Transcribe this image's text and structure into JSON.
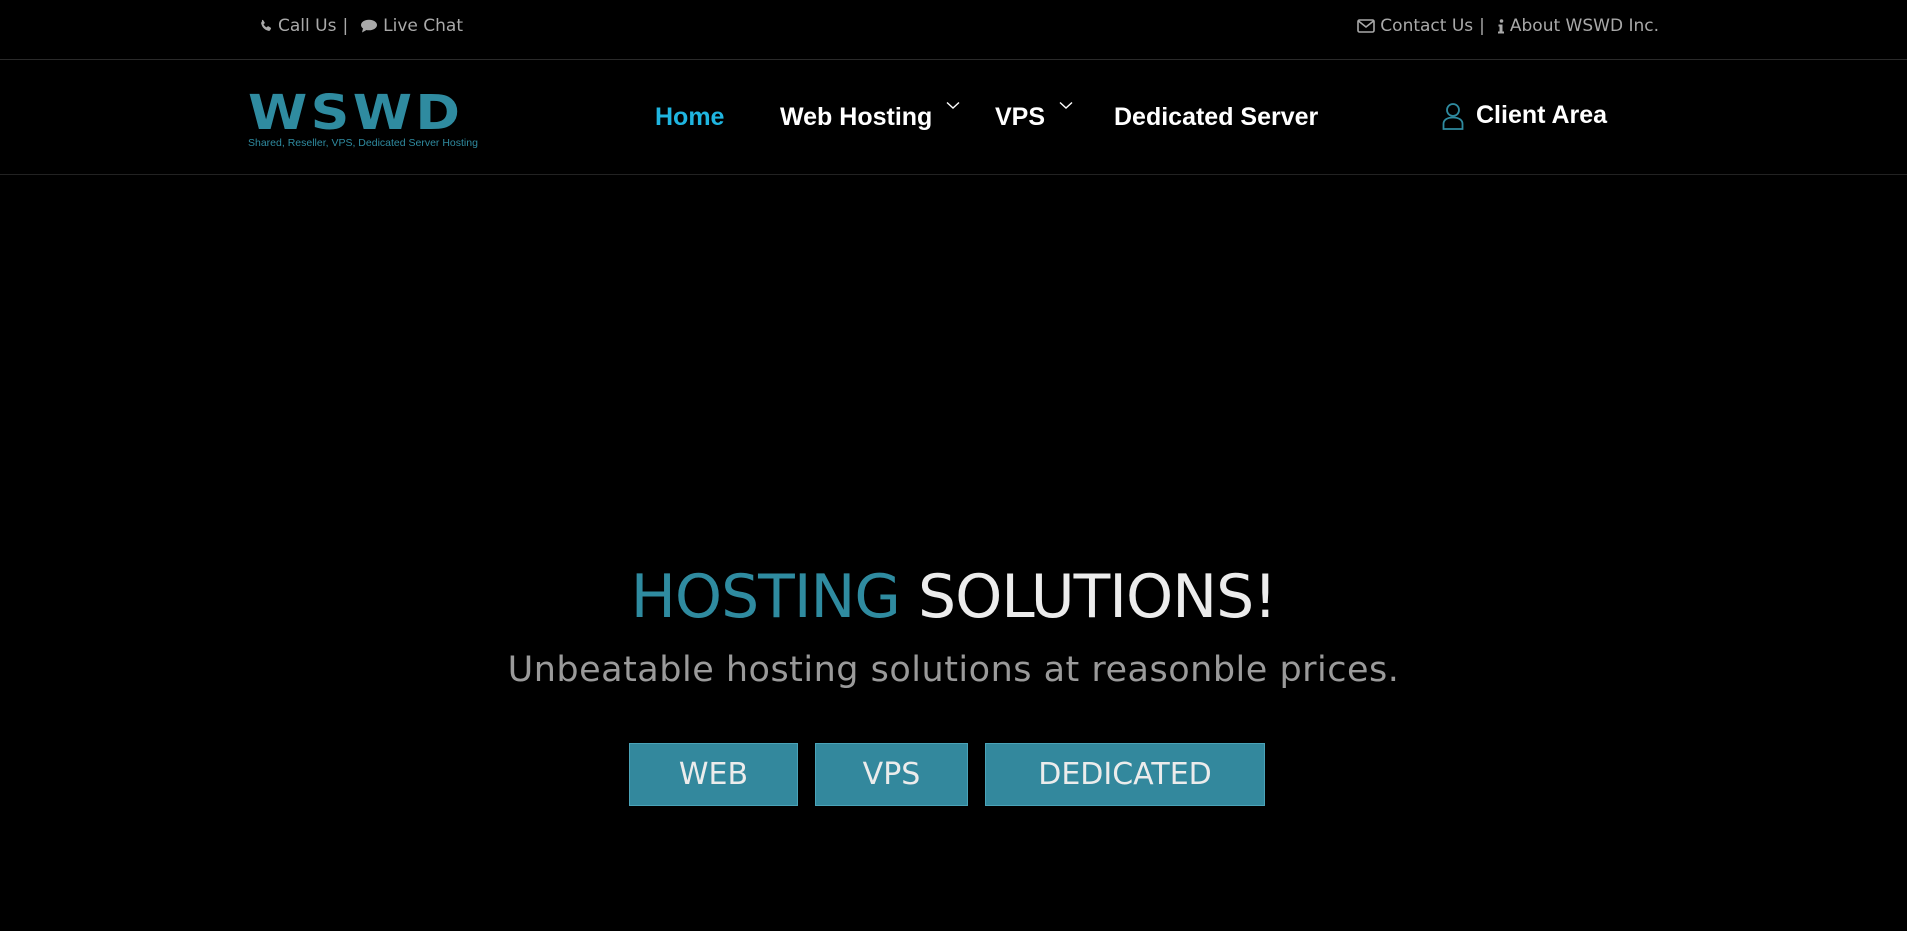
{
  "topbar": {
    "call_label": "Call Us",
    "chat_label": "Live Chat",
    "contact_label": "Contact Us",
    "about_label": "About WSWD Inc.",
    "separator": "|"
  },
  "logo": {
    "wordmark": "WSWD",
    "tagline": "Shared, Reseller, VPS, Dedicated Server Hosting"
  },
  "nav": {
    "home": "Home",
    "web_hosting": "Web Hosting",
    "vps": "VPS",
    "dedicated": "Dedicated Server",
    "client_area": "Client Area"
  },
  "hero": {
    "title_highlight": "HOSTING",
    "title_rest": "SOLUTIONS!",
    "subtitle": "Unbeatable hosting solutions at reasonble prices.",
    "btn_web": "WEB",
    "btn_vps": "VPS",
    "btn_dedicated": "DEDICATED"
  },
  "colors": {
    "brand": "#2f8ba0",
    "nav_active": "#1fb5e0",
    "button_bg": "#33889d",
    "background": "#000000"
  },
  "icons": {
    "call": "phone-icon",
    "chat": "chat-bubble-icon",
    "contact": "envelope-icon",
    "about": "info-icon",
    "dropdown": "chevron-down-icon",
    "client": "user-icon"
  }
}
